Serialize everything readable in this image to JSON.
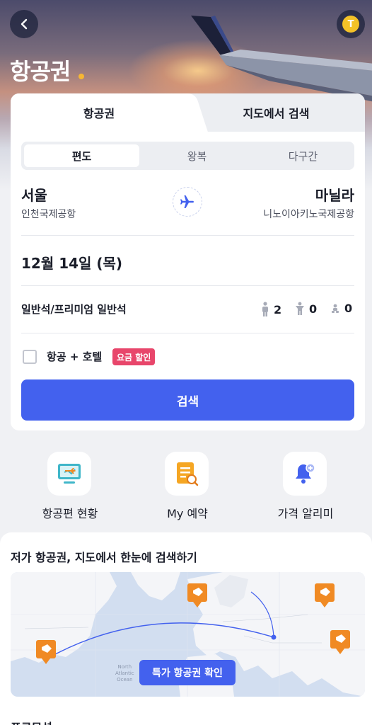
{
  "header": {
    "title": "항공권",
    "profile_initial": "T",
    "accent_dot": "#f7b733"
  },
  "tabs": [
    {
      "label": "항공권",
      "active": true
    },
    {
      "label": "지도에서 검색",
      "active": false
    }
  ],
  "trip_type": {
    "options": [
      "편도",
      "왕복",
      "다구간"
    ],
    "selected": "편도"
  },
  "origin": {
    "city": "서울",
    "airport": "인천국제공항"
  },
  "destination": {
    "city": "마닐라",
    "airport": "니노이아키노국제공항"
  },
  "date": "12월 14일 (목)",
  "cabin": "일반석/프리미엄 일반석",
  "passengers": {
    "adult": "2",
    "child": "0",
    "infant": "0"
  },
  "combo": {
    "label": "항공 + 호텔",
    "badge": "요금 할인",
    "checked": false
  },
  "search_button": "검색",
  "quick_menu": [
    {
      "label": "항공편 현황",
      "icon": "flight-status-icon"
    },
    {
      "label": "My 예약",
      "icon": "reservation-icon"
    },
    {
      "label": "가격 알리미",
      "icon": "price-alert-bell-icon"
    }
  ],
  "map_section": {
    "title": "저가 항공권, 지도에서 한눈에 검색하기",
    "button": "특가 항공권 확인",
    "ocean_label_1": "North",
    "ocean_label_2": "Atlantic",
    "ocean_label_3": "Ocean"
  },
  "promo": {
    "title": "프로모션"
  },
  "colors": {
    "primary": "#4361ee",
    "badge": "#e8466b",
    "tag": "#f08a24"
  }
}
